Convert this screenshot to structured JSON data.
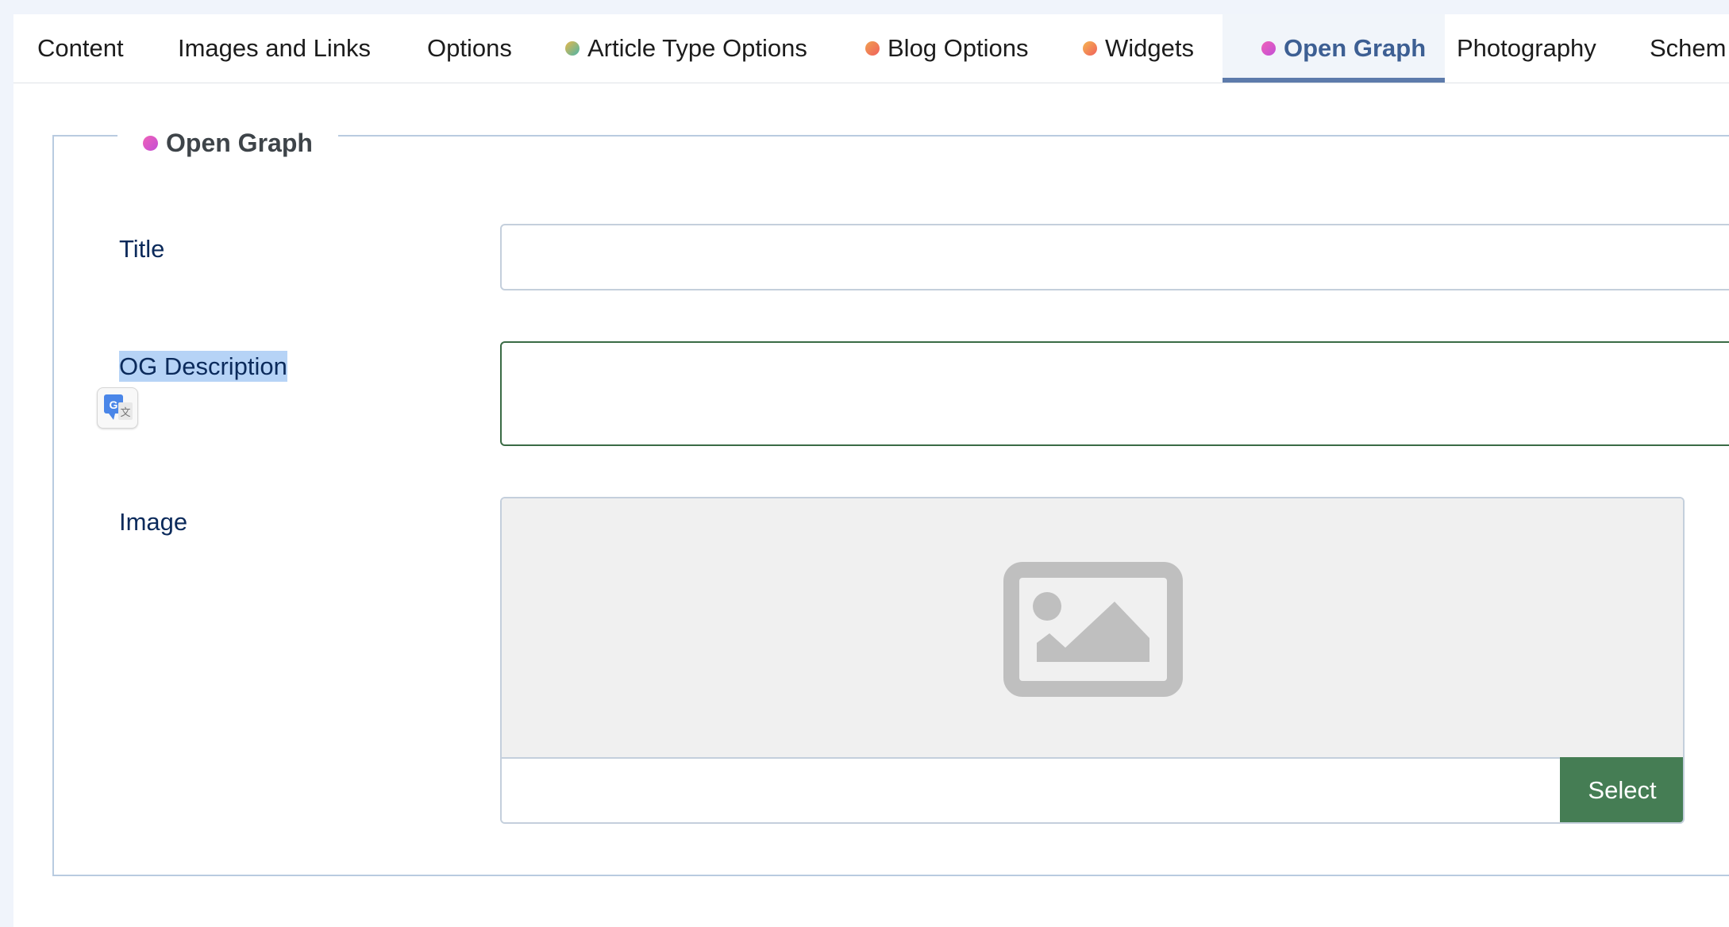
{
  "tabs": [
    {
      "label": "Content",
      "dot": null,
      "active": false
    },
    {
      "label": "Images and Links",
      "dot": null,
      "active": false
    },
    {
      "label": "Options",
      "dot": null,
      "active": false
    },
    {
      "label": "Article Type Options",
      "dot": "#7ab86a",
      "active": false
    },
    {
      "label": "Blog Options",
      "dot": "#f57a5c",
      "active": false
    },
    {
      "label": "Widgets",
      "dot": "#f58a5c",
      "active": false
    },
    {
      "label": "Open Graph",
      "dot": "#e05fc8",
      "active": true
    },
    {
      "label": "Photography",
      "dot": null,
      "active": false
    },
    {
      "label": "Schem",
      "dot": null,
      "active": false
    }
  ],
  "fieldset": {
    "legend": "Open Graph",
    "legend_icon": "pink-dot-icon"
  },
  "fields": {
    "title": {
      "label": "Title",
      "value": ""
    },
    "og_description": {
      "label": "OG Description",
      "value": ""
    },
    "image": {
      "label": "Image",
      "value": "",
      "button": "Select",
      "preview_icon": "image-placeholder-icon"
    }
  },
  "translate_icon": "google-translate-icon",
  "colors": {
    "active_tab": "#3d5f93",
    "select_button": "#457d54",
    "focus_border": "#3a6b45",
    "selection_highlight": "#b6d3f6"
  }
}
